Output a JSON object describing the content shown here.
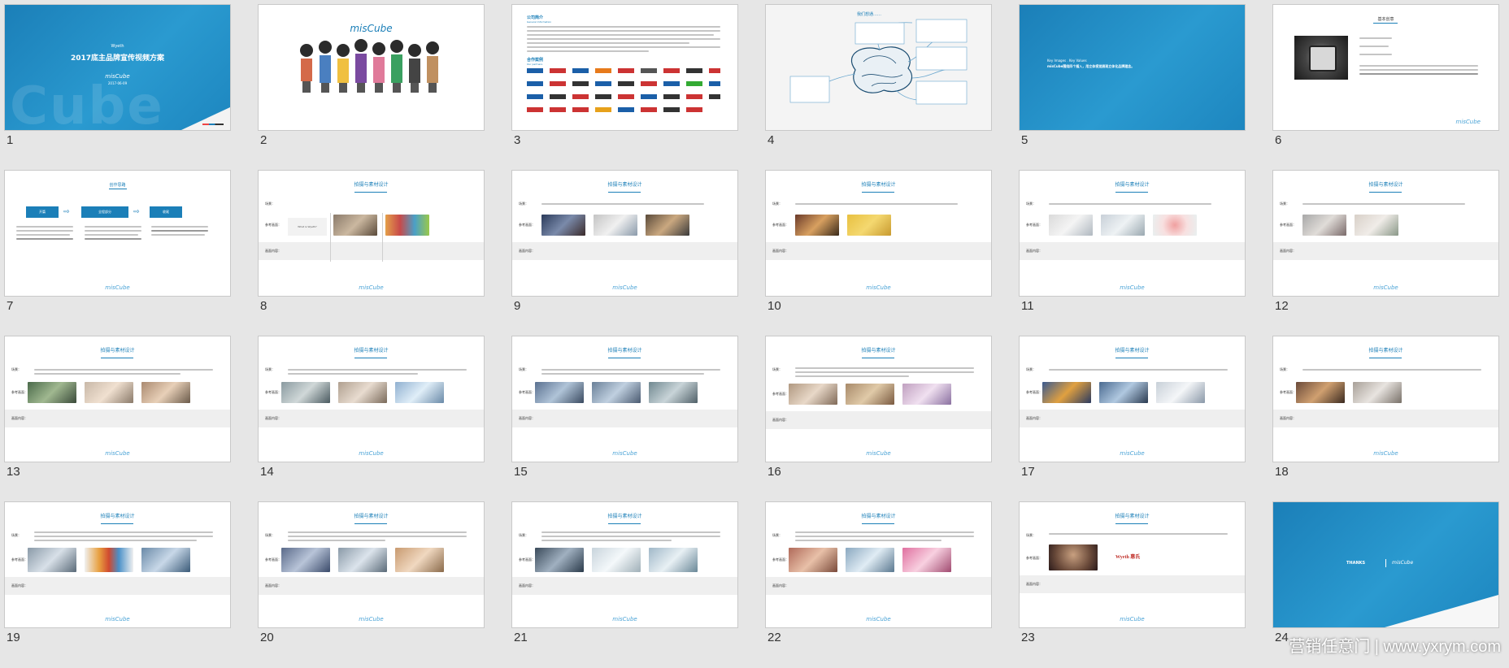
{
  "slides": {
    "s1": {
      "num": "1",
      "brand": "Wyeth",
      "title": "2017底主品牌宣传视频方案",
      "logo": "misCube",
      "date": "2017-06-09",
      "colors": {
        "bg": "#1b7fb8"
      }
    },
    "s2": {
      "num": "2",
      "logo": "misCube"
    },
    "s3": {
      "num": "3",
      "heading": "公司简介",
      "heading_en": "General Information",
      "clients": "合作案例",
      "clients_en": "Our partners"
    },
    "s4": {
      "num": "4",
      "center": "我们想通……"
    },
    "s5": {
      "num": "5",
      "line1": "Key Images . Key Values",
      "line2": "misCube围绕四个插入，用立体视觉展现立体化品牌理念。"
    },
    "s6": {
      "num": "6",
      "title": "基本创意",
      "logo": "misCube"
    },
    "s7": {
      "num": "7",
      "title": "创作思路",
      "box1": "开篇",
      "box2": "全程部分",
      "box3": "收尾",
      "logo": "misCube"
    },
    "s8": {
      "num": "8",
      "title": "拍摄与素材设计",
      "q": "What is Wyeth?",
      "logo": "misCube"
    },
    "s9": {
      "num": "9",
      "title": "拍摄与素材设计",
      "logo": "misCube"
    },
    "s10": {
      "num": "10",
      "title": "拍摄与素材设计",
      "logo": "misCube"
    },
    "s11": {
      "num": "11",
      "title": "拍摄与素材设计",
      "logo": "misCube"
    },
    "s12": {
      "num": "12",
      "title": "拍摄与素材设计",
      "logo": "misCube"
    },
    "s13": {
      "num": "13",
      "title": "拍摄与素材设计",
      "logo": "misCube"
    },
    "s14": {
      "num": "14",
      "title": "拍摄与素材设计",
      "logo": "misCube"
    },
    "s15": {
      "num": "15",
      "title": "拍摄与素材设计",
      "logo": "misCube"
    },
    "s16": {
      "num": "16",
      "title": "拍摄与素材设计",
      "logo": "misCube"
    },
    "s17": {
      "num": "17",
      "title": "拍摄与素材设计",
      "logo": "misCube"
    },
    "s18": {
      "num": "18",
      "title": "拍摄与素材设计",
      "logo": "misCube"
    },
    "s19": {
      "num": "19",
      "title": "拍摄与素材设计",
      "logo": "misCube"
    },
    "s20": {
      "num": "20",
      "title": "拍摄与素材设计",
      "logo": "misCube"
    },
    "s21": {
      "num": "21",
      "title": "拍摄与素材设计",
      "logo": "misCube"
    },
    "s22": {
      "num": "22",
      "title": "拍摄与素材设计",
      "logo": "misCube"
    },
    "s23": {
      "num": "23",
      "title": "拍摄与素材设计",
      "wyeth": "Wyeth 惠氏",
      "logo": "misCube"
    },
    "s24": {
      "num": "24",
      "thanks": "THANKS",
      "logo": "misCube"
    }
  },
  "row_labels": {
    "r1": "场景：",
    "r2": "参考画面：",
    "r3": "画面内容："
  },
  "watermark": "营销任意门 | www.yxrym.com"
}
